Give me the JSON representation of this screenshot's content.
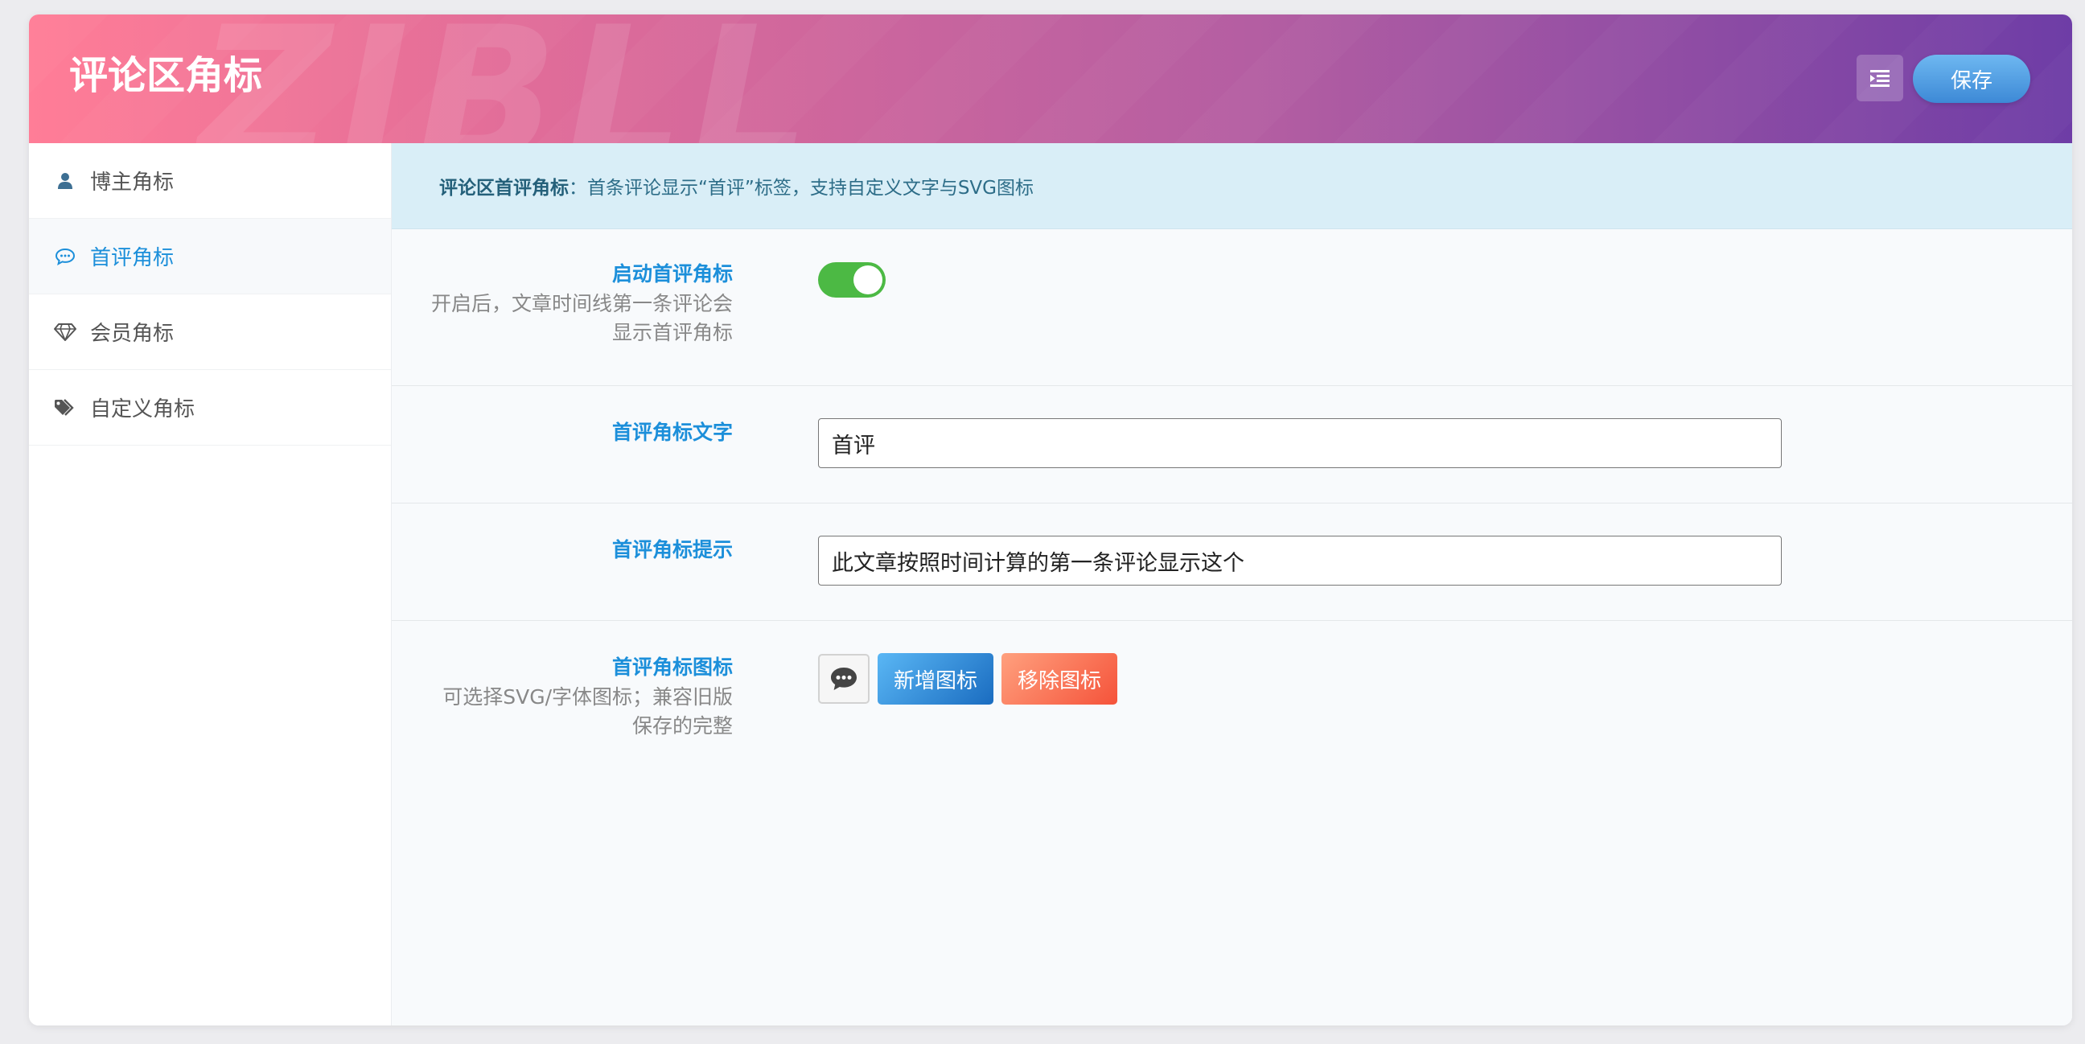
{
  "header": {
    "title": "评论区角标",
    "watermark": "ZIBLL",
    "menu_icon": "indent-left-icon",
    "save_label": "保存"
  },
  "sidebar": {
    "items": [
      {
        "label": "博主角标",
        "icon": "user-icon",
        "active": false
      },
      {
        "label": "首评角标",
        "icon": "comment-dots-icon",
        "active": true
      },
      {
        "label": "会员角标",
        "icon": "diamond-icon",
        "active": false
      },
      {
        "label": "自定义角标",
        "icon": "tags-icon",
        "active": false
      }
    ]
  },
  "notice": {
    "title": "评论区首评角标",
    "text": "：首条评论显示“首评”标签，支持自定义文字与SVG图标"
  },
  "fields": {
    "enable": {
      "label": "启动首评角标",
      "desc_line1": "开启后，文章时间线第一条评论会",
      "desc_line2": "显示首评角标",
      "on": true
    },
    "text": {
      "label": "首评角标文字",
      "value": "首评"
    },
    "tip": {
      "label": "首评角标提示",
      "value": "此文章按照时间计算的第一条评论显示这个"
    },
    "icon": {
      "label": "首评角标图标",
      "desc_line1": "可选择SVG/字体图标；兼容旧版",
      "desc_line2": "保存的完整",
      "preview_icon": "comment-dots-icon",
      "add_label": "新增图标",
      "remove_label": "移除图标"
    }
  },
  "colors": {
    "accent": "#1c8fda",
    "toggle_on": "#4cb944",
    "header_start": "#ff7d97",
    "header_end": "#6e3da6",
    "notice_bg": "#d9eef7"
  }
}
